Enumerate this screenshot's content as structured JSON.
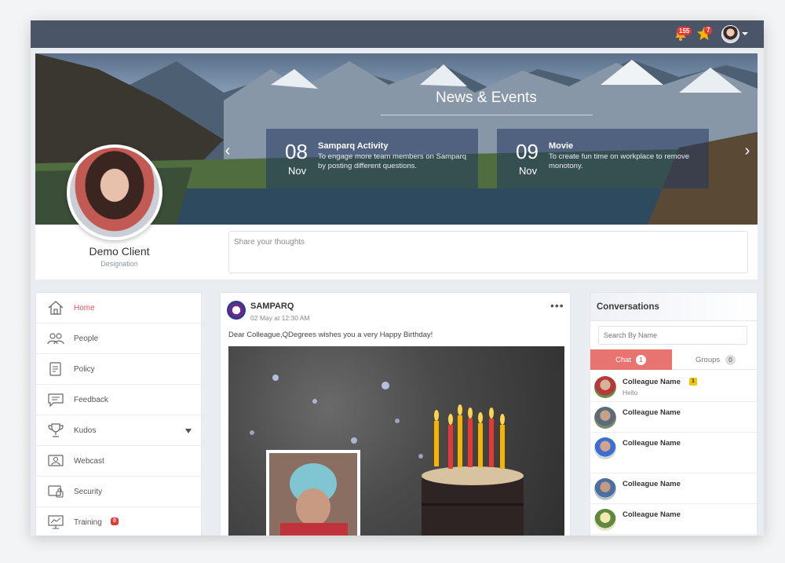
{
  "topbar": {
    "notifications_count": "155",
    "stars_count": "7"
  },
  "banner": {
    "title": "News & Events",
    "events": [
      {
        "day": "08",
        "month": "Nov",
        "name": "Samparq Activity",
        "description": "To engage more team members on Samparq by posting different questions."
      },
      {
        "day": "09",
        "month": "Nov",
        "name": "Movie",
        "description": "To create fun time on workplace to remove monotony."
      }
    ],
    "prev_icon": "chevron-left-icon",
    "next_icon": "chevron-right-icon"
  },
  "profile": {
    "name": "Demo Client",
    "designation": "Designation"
  },
  "share": {
    "placeholder": "Share your thoughts"
  },
  "sidebar": {
    "items": [
      {
        "label": "Home",
        "icon": "home-icon",
        "active": true
      },
      {
        "label": "People",
        "icon": "people-icon"
      },
      {
        "label": "Policy",
        "icon": "policy-icon"
      },
      {
        "label": "Feedback",
        "icon": "feedback-icon"
      },
      {
        "label": "Kudos",
        "icon": "trophy-icon",
        "has_submenu": true
      },
      {
        "label": "Webcast",
        "icon": "webcast-icon"
      },
      {
        "label": "Security",
        "icon": "security-icon"
      },
      {
        "label": "Training",
        "icon": "training-icon",
        "badge": "0"
      }
    ]
  },
  "post": {
    "author": "SAMPARQ",
    "timestamp": "02 May at 12:30 AM",
    "text": "Dear Colleague,QDegrees wishes you a very Happy Birthday!",
    "more": "•••"
  },
  "conversations": {
    "title": "Conversations",
    "search_placeholder": "Search By Name",
    "tabs": [
      {
        "label": "Chat",
        "badge": "1"
      },
      {
        "label": "Groups",
        "badge": "0"
      }
    ],
    "contacts": [
      {
        "name": "Colleague Name",
        "message": "Hello",
        "badge": "1"
      },
      {
        "name": "Colleague Name",
        "message": ""
      },
      {
        "name": "Colleague Name",
        "message": ""
      },
      {
        "name": "Colleague Name",
        "message": ""
      },
      {
        "name": "Colleague Name",
        "message": ""
      }
    ]
  },
  "colors": {
    "topbar": "#4a5568",
    "accent": "#e8505b",
    "chat_tab": "#e87472",
    "badge_red": "#e53935",
    "badge_yellow": "#f1c40f"
  }
}
